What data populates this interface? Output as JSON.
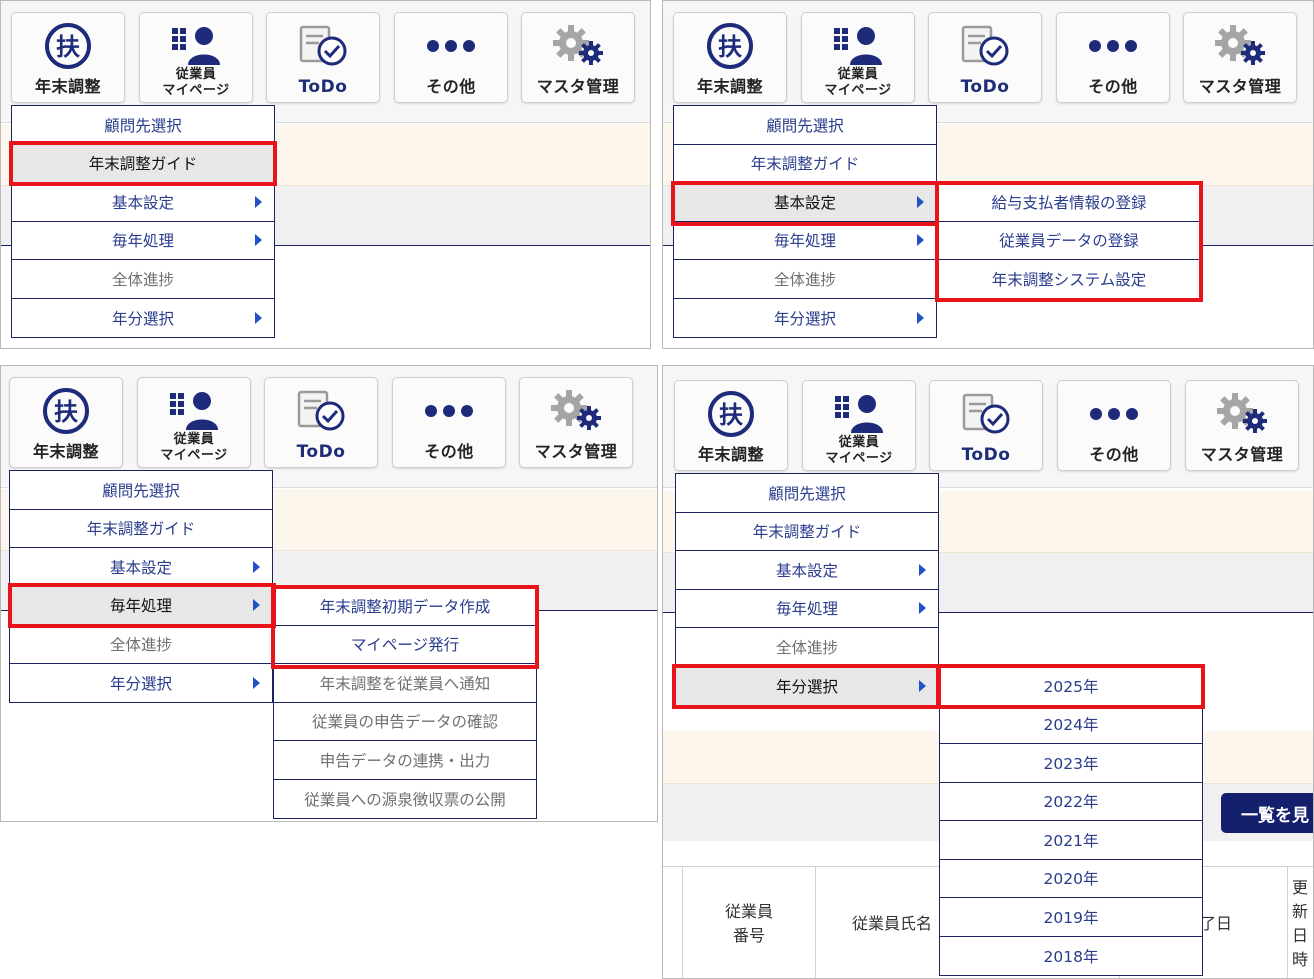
{
  "toolbar": {
    "nenmatsu": "年末調整",
    "employee_l1": "従業員",
    "employee_l2": "マイページ",
    "todo": "ToDo",
    "other": "その他",
    "master": "マスタ管理"
  },
  "menu": {
    "items": [
      "顧問先選択",
      "年末調整ガイド",
      "基本設定",
      "毎年処理",
      "全体進捗",
      "年分選択"
    ]
  },
  "submenu_kihon": {
    "items": [
      "給与支払者情報の登録",
      "従業員データの登録",
      "年末調整システム設定"
    ]
  },
  "submenu_mainen": {
    "items": [
      "年末調整初期データ作成",
      "マイページ発行",
      "年末調整を従業員へ通知",
      "従業員の申告データの確認",
      "申告データの連携・出力",
      "従業員への源泉徴収票の公開"
    ]
  },
  "submenu_year": {
    "items": [
      "2025年",
      "2024年",
      "2023年",
      "2022年",
      "2021年",
      "2020年",
      "2019年",
      "2018年"
    ]
  },
  "list_button": "一覧を見",
  "table_header": {
    "col_number_l1": "従業員",
    "col_number_l2": "番号",
    "col_name": "従業員氏名",
    "col_date": "了日",
    "col_updated": [
      "更",
      "新",
      "日",
      "時"
    ]
  },
  "colors": {
    "menu_border": "#1a2360",
    "menu_text": "#2a3c8c",
    "highlight_red": "#e8141a",
    "arrow_blue": "#2251c6",
    "cream_band": "#fdf6ec"
  }
}
